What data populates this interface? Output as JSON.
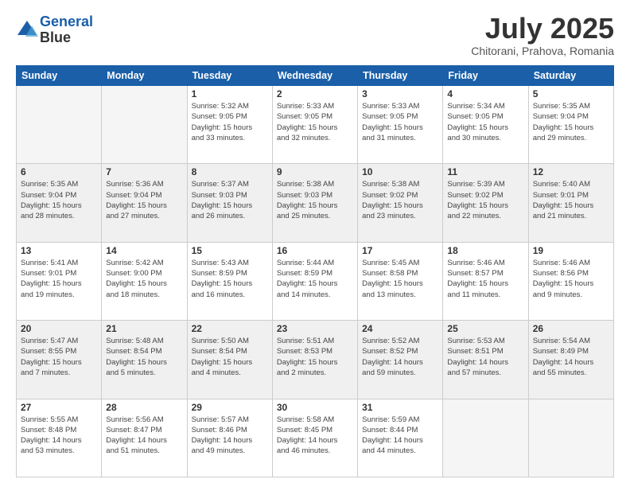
{
  "header": {
    "logo_line1": "General",
    "logo_line2": "Blue",
    "month": "July 2025",
    "location": "Chitorani, Prahova, Romania"
  },
  "days_of_week": [
    "Sunday",
    "Monday",
    "Tuesday",
    "Wednesday",
    "Thursday",
    "Friday",
    "Saturday"
  ],
  "weeks": [
    {
      "shaded": false,
      "days": [
        {
          "num": "",
          "info": ""
        },
        {
          "num": "",
          "info": ""
        },
        {
          "num": "1",
          "info": "Sunrise: 5:32 AM\nSunset: 9:05 PM\nDaylight: 15 hours\nand 33 minutes."
        },
        {
          "num": "2",
          "info": "Sunrise: 5:33 AM\nSunset: 9:05 PM\nDaylight: 15 hours\nand 32 minutes."
        },
        {
          "num": "3",
          "info": "Sunrise: 5:33 AM\nSunset: 9:05 PM\nDaylight: 15 hours\nand 31 minutes."
        },
        {
          "num": "4",
          "info": "Sunrise: 5:34 AM\nSunset: 9:05 PM\nDaylight: 15 hours\nand 30 minutes."
        },
        {
          "num": "5",
          "info": "Sunrise: 5:35 AM\nSunset: 9:04 PM\nDaylight: 15 hours\nand 29 minutes."
        }
      ]
    },
    {
      "shaded": true,
      "days": [
        {
          "num": "6",
          "info": "Sunrise: 5:35 AM\nSunset: 9:04 PM\nDaylight: 15 hours\nand 28 minutes."
        },
        {
          "num": "7",
          "info": "Sunrise: 5:36 AM\nSunset: 9:04 PM\nDaylight: 15 hours\nand 27 minutes."
        },
        {
          "num": "8",
          "info": "Sunrise: 5:37 AM\nSunset: 9:03 PM\nDaylight: 15 hours\nand 26 minutes."
        },
        {
          "num": "9",
          "info": "Sunrise: 5:38 AM\nSunset: 9:03 PM\nDaylight: 15 hours\nand 25 minutes."
        },
        {
          "num": "10",
          "info": "Sunrise: 5:38 AM\nSunset: 9:02 PM\nDaylight: 15 hours\nand 23 minutes."
        },
        {
          "num": "11",
          "info": "Sunrise: 5:39 AM\nSunset: 9:02 PM\nDaylight: 15 hours\nand 22 minutes."
        },
        {
          "num": "12",
          "info": "Sunrise: 5:40 AM\nSunset: 9:01 PM\nDaylight: 15 hours\nand 21 minutes."
        }
      ]
    },
    {
      "shaded": false,
      "days": [
        {
          "num": "13",
          "info": "Sunrise: 5:41 AM\nSunset: 9:01 PM\nDaylight: 15 hours\nand 19 minutes."
        },
        {
          "num": "14",
          "info": "Sunrise: 5:42 AM\nSunset: 9:00 PM\nDaylight: 15 hours\nand 18 minutes."
        },
        {
          "num": "15",
          "info": "Sunrise: 5:43 AM\nSunset: 8:59 PM\nDaylight: 15 hours\nand 16 minutes."
        },
        {
          "num": "16",
          "info": "Sunrise: 5:44 AM\nSunset: 8:59 PM\nDaylight: 15 hours\nand 14 minutes."
        },
        {
          "num": "17",
          "info": "Sunrise: 5:45 AM\nSunset: 8:58 PM\nDaylight: 15 hours\nand 13 minutes."
        },
        {
          "num": "18",
          "info": "Sunrise: 5:46 AM\nSunset: 8:57 PM\nDaylight: 15 hours\nand 11 minutes."
        },
        {
          "num": "19",
          "info": "Sunrise: 5:46 AM\nSunset: 8:56 PM\nDaylight: 15 hours\nand 9 minutes."
        }
      ]
    },
    {
      "shaded": true,
      "days": [
        {
          "num": "20",
          "info": "Sunrise: 5:47 AM\nSunset: 8:55 PM\nDaylight: 15 hours\nand 7 minutes."
        },
        {
          "num": "21",
          "info": "Sunrise: 5:48 AM\nSunset: 8:54 PM\nDaylight: 15 hours\nand 5 minutes."
        },
        {
          "num": "22",
          "info": "Sunrise: 5:50 AM\nSunset: 8:54 PM\nDaylight: 15 hours\nand 4 minutes."
        },
        {
          "num": "23",
          "info": "Sunrise: 5:51 AM\nSunset: 8:53 PM\nDaylight: 15 hours\nand 2 minutes."
        },
        {
          "num": "24",
          "info": "Sunrise: 5:52 AM\nSunset: 8:52 PM\nDaylight: 14 hours\nand 59 minutes."
        },
        {
          "num": "25",
          "info": "Sunrise: 5:53 AM\nSunset: 8:51 PM\nDaylight: 14 hours\nand 57 minutes."
        },
        {
          "num": "26",
          "info": "Sunrise: 5:54 AM\nSunset: 8:49 PM\nDaylight: 14 hours\nand 55 minutes."
        }
      ]
    },
    {
      "shaded": false,
      "days": [
        {
          "num": "27",
          "info": "Sunrise: 5:55 AM\nSunset: 8:48 PM\nDaylight: 14 hours\nand 53 minutes."
        },
        {
          "num": "28",
          "info": "Sunrise: 5:56 AM\nSunset: 8:47 PM\nDaylight: 14 hours\nand 51 minutes."
        },
        {
          "num": "29",
          "info": "Sunrise: 5:57 AM\nSunset: 8:46 PM\nDaylight: 14 hours\nand 49 minutes."
        },
        {
          "num": "30",
          "info": "Sunrise: 5:58 AM\nSunset: 8:45 PM\nDaylight: 14 hours\nand 46 minutes."
        },
        {
          "num": "31",
          "info": "Sunrise: 5:59 AM\nSunset: 8:44 PM\nDaylight: 14 hours\nand 44 minutes."
        },
        {
          "num": "",
          "info": ""
        },
        {
          "num": "",
          "info": ""
        }
      ]
    }
  ]
}
